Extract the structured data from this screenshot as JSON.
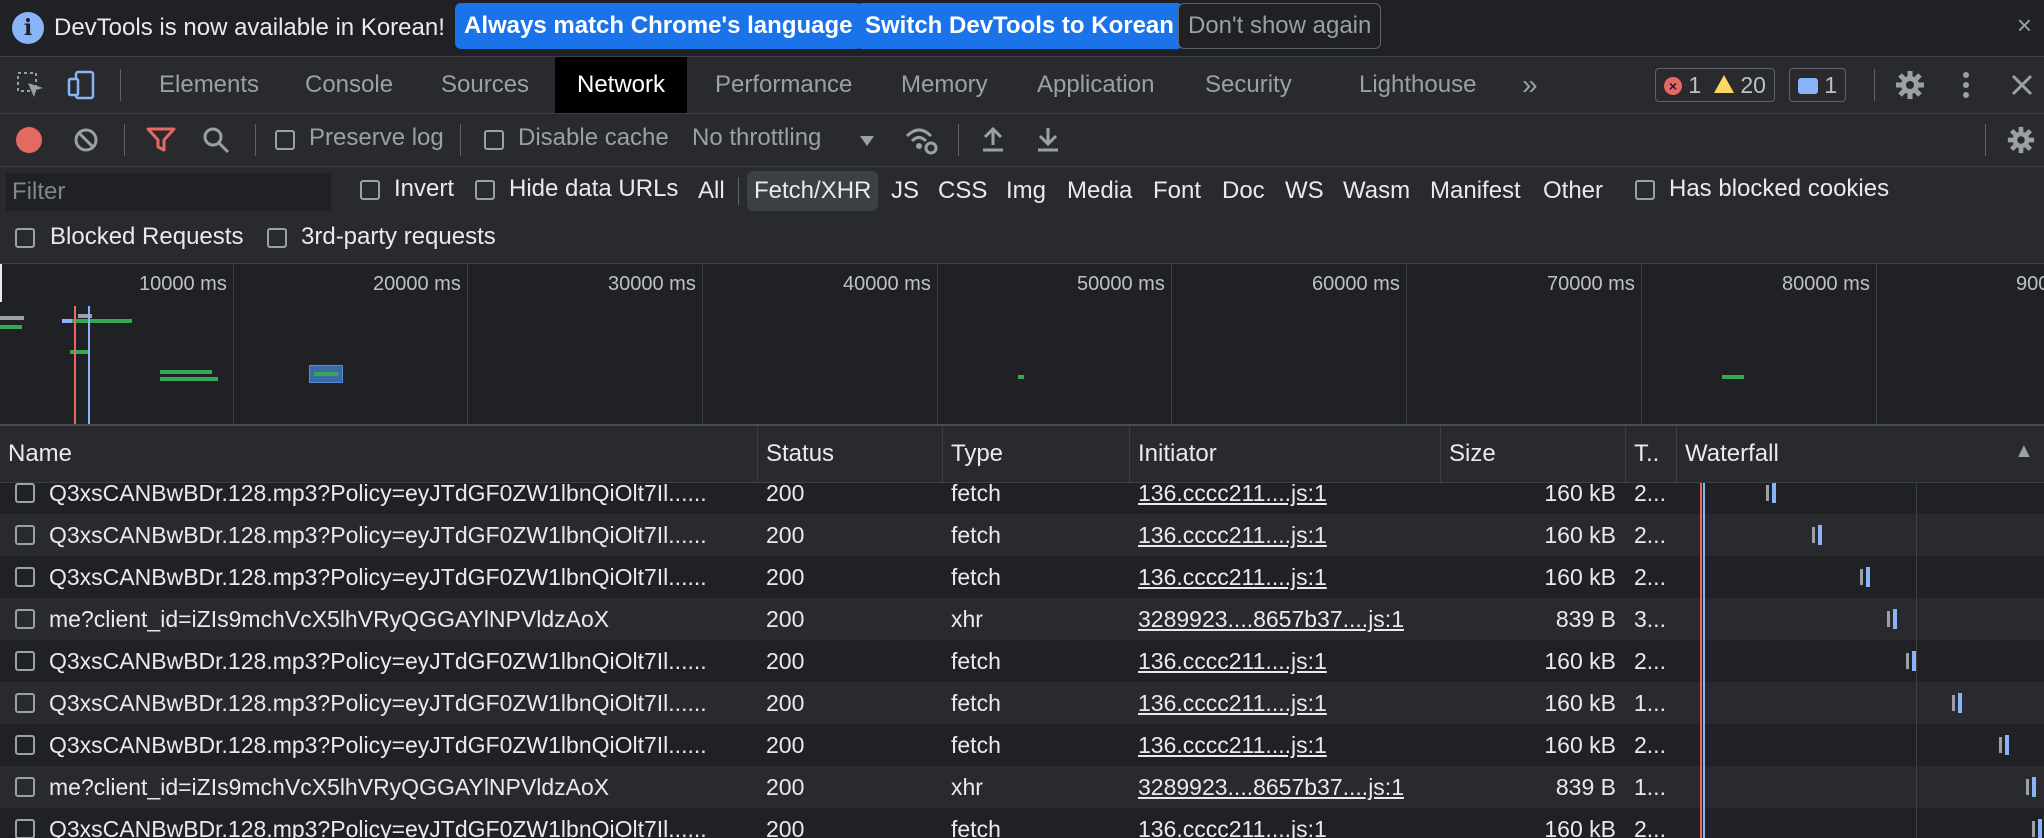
{
  "infobar": {
    "message": "DevTools is now available in Korean!",
    "btn_always": "Always match Chrome's language",
    "btn_switch": "Switch DevTools to Korean",
    "btn_dont_show": "Don't show again",
    "close": "×"
  },
  "tabs": [
    "Elements",
    "Console",
    "Sources",
    "Network",
    "Performance",
    "Memory",
    "Application",
    "Security",
    "Lighthouse"
  ],
  "tabs_more": "»",
  "counters": {
    "errors": "1",
    "warnings": "20",
    "messages": "1"
  },
  "toolbar": {
    "preserve_log": "Preserve log",
    "disable_cache": "Disable cache",
    "throttling": "No throttling"
  },
  "filter": {
    "placeholder": "Filter",
    "invert": "Invert",
    "hide_data_urls": "Hide data URLs",
    "types": [
      "All",
      "Fetch/XHR",
      "JS",
      "CSS",
      "Img",
      "Media",
      "Font",
      "Doc",
      "WS",
      "Wasm",
      "Manifest",
      "Other"
    ],
    "active_type": "Fetch/XHR",
    "has_blocked_cookies": "Has blocked cookies",
    "blocked_requests": "Blocked Requests",
    "third_party": "3rd-party requests"
  },
  "overview": {
    "labels": [
      "10000 ms",
      "20000 ms",
      "30000 ms",
      "40000 ms",
      "50000 ms",
      "60000 ms",
      "70000 ms",
      "80000 ms",
      "900"
    ]
  },
  "table": {
    "headers": {
      "name": "Name",
      "status": "Status",
      "type": "Type",
      "initiator": "Initiator",
      "size": "Size",
      "time": "T..",
      "waterfall": "Waterfall",
      "sort": "▲"
    },
    "rows": [
      {
        "name": "Q3xsCANBwBDr.128.mp3?Policy=eyJTdGF0ZW1lbnQiOlt7Il......",
        "status": "200",
        "type": "fetch",
        "initiator": "136.cccc211....js:1",
        "size": "160 kB",
        "time": "2..."
      },
      {
        "name": "Q3xsCANBwBDr.128.mp3?Policy=eyJTdGF0ZW1lbnQiOlt7Il......",
        "status": "200",
        "type": "fetch",
        "initiator": "136.cccc211....js:1",
        "size": "160 kB",
        "time": "2..."
      },
      {
        "name": "Q3xsCANBwBDr.128.mp3?Policy=eyJTdGF0ZW1lbnQiOlt7Il......",
        "status": "200",
        "type": "fetch",
        "initiator": "136.cccc211....js:1",
        "size": "160 kB",
        "time": "2..."
      },
      {
        "name": "me?client_id=iZIs9mchVcX5lhVRyQGGAYlNPVldzAoX",
        "status": "200",
        "type": "xhr",
        "initiator": "3289923....8657b37....js:1",
        "size": "839 B",
        "time": "3..."
      },
      {
        "name": "Q3xsCANBwBDr.128.mp3?Policy=eyJTdGF0ZW1lbnQiOlt7Il......",
        "status": "200",
        "type": "fetch",
        "initiator": "136.cccc211....js:1",
        "size": "160 kB",
        "time": "2..."
      },
      {
        "name": "Q3xsCANBwBDr.128.mp3?Policy=eyJTdGF0ZW1lbnQiOlt7Il......",
        "status": "200",
        "type": "fetch",
        "initiator": "136.cccc211....js:1",
        "size": "160 kB",
        "time": "1..."
      },
      {
        "name": "Q3xsCANBwBDr.128.mp3?Policy=eyJTdGF0ZW1lbnQiOlt7Il......",
        "status": "200",
        "type": "fetch",
        "initiator": "136.cccc211....js:1",
        "size": "160 kB",
        "time": "2..."
      },
      {
        "name": "me?client_id=iZIs9mchVcX5lhVRyQGGAYlNPVldzAoX",
        "status": "200",
        "type": "xhr",
        "initiator": "3289923....8657b37....js:1",
        "size": "839 B",
        "time": "1..."
      },
      {
        "name": "Q3xsCANBwBDr.128.mp3?Policy=eyJTdGF0ZW1lbnQiOlt7Il......",
        "status": "200",
        "type": "fetch",
        "initiator": "136.cccc211....js:1",
        "size": "160 kB",
        "time": "2..."
      }
    ]
  },
  "icons": {
    "info": "info-icon",
    "inspect": "inspect-element-icon",
    "device": "device-toolbar-icon",
    "record": "record-icon",
    "clear": "clear-icon",
    "filter": "filter-icon",
    "search": "search-icon",
    "network_conditions": "network-conditions-icon",
    "import": "import-har-icon",
    "export": "export-har-icon",
    "settings": "gear-icon",
    "menu": "kebab-menu-icon",
    "close": "close-icon"
  },
  "colors": {
    "accent": "#1a73e8",
    "record": "#e46962",
    "filter_active": "#e46962",
    "bar": "#34a853",
    "waterfall": "#8ab4f8"
  }
}
